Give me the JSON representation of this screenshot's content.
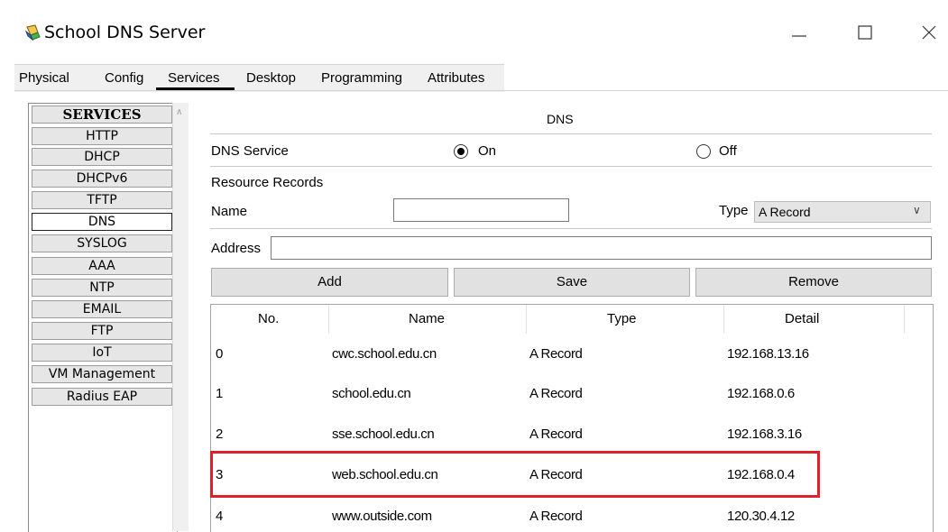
{
  "window": {
    "title": "School DNS Server",
    "icon": "pc-server-icon",
    "controls": [
      "minimize-icon",
      "maximize-icon",
      "close-icon"
    ]
  },
  "tabs": [
    "Physical",
    "Config",
    "Services",
    "Desktop",
    "Programming",
    "Attributes"
  ],
  "active_tab": "Services",
  "services": {
    "header": "SERVICES",
    "items": [
      "HTTP",
      "DHCP",
      "DHCPv6",
      "TFTP",
      "DNS",
      "SYSLOG",
      "AAA",
      "NTP",
      "EMAIL",
      "FTP",
      "IoT",
      "VM Management",
      "Radius EAP"
    ],
    "selected": "DNS"
  },
  "dns": {
    "header": "DNS",
    "service_label": "DNS Service",
    "on_label": "On",
    "off_label": "Off",
    "service_state": "On",
    "resource_records_label": "Resource Records",
    "name_label": "Name",
    "name_value": "",
    "type_label": "Type",
    "type_value": "A Record",
    "address_label": "Address",
    "address_value": "",
    "buttons": {
      "add": "Add",
      "save": "Save",
      "remove": "Remove"
    }
  },
  "table": {
    "columns": [
      "No.",
      "Name",
      "Type",
      "Detail"
    ],
    "rows": [
      {
        "no": "0",
        "name": "cwc.school.edu.cn",
        "type": "A Record",
        "detail": "192.168.13.16"
      },
      {
        "no": "1",
        "name": "school.edu.cn",
        "type": "A Record",
        "detail": "192.168.0.6"
      },
      {
        "no": "2",
        "name": "sse.school.edu.cn",
        "type": "A Record",
        "detail": "192.168.3.16"
      },
      {
        "no": "3",
        "name": "web.school.edu.cn",
        "type": "A Record",
        "detail": "192.168.0.4"
      },
      {
        "no": "4",
        "name": "www.outside.com",
        "type": "A Record",
        "detail": "120.30.4.12"
      }
    ],
    "highlighted_row": 3,
    "highlight_color": "#e0202a"
  }
}
